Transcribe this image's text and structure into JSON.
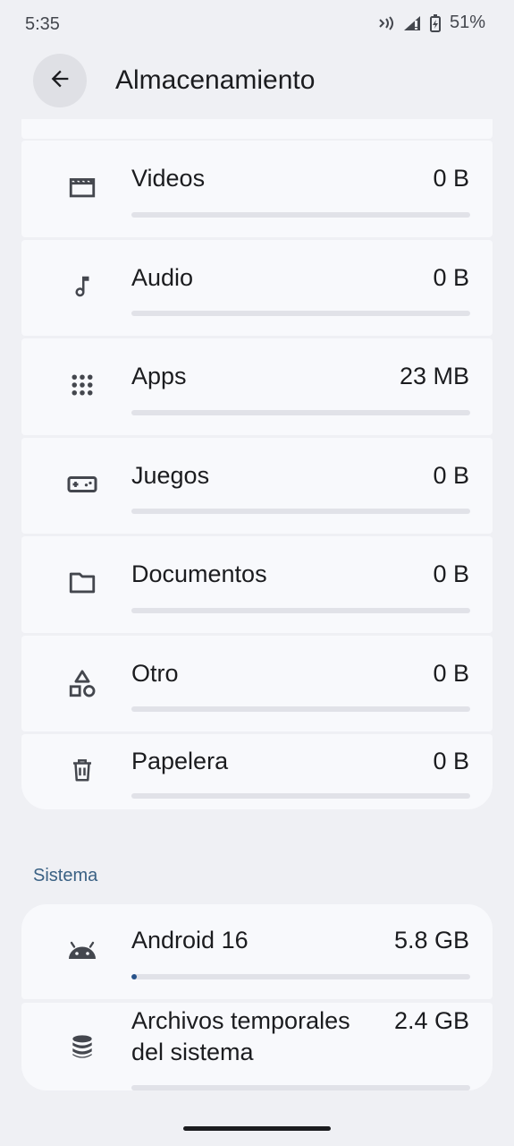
{
  "status_bar": {
    "time": "5:35",
    "battery": "51%",
    "icons": [
      "nfc-icon",
      "signal-icon",
      "battery-icon"
    ]
  },
  "app_bar": {
    "title": "Almacenamiento",
    "back_icon": "arrow-back-icon"
  },
  "categories": [
    {
      "label": "Videos",
      "value": "0 B",
      "icon": "movie-icon",
      "usage_fraction": 0
    },
    {
      "label": "Audio",
      "value": "0 B",
      "icon": "music-note-icon",
      "usage_fraction": 0
    },
    {
      "label": "Apps",
      "value": "23 MB",
      "icon": "apps-grid-icon",
      "usage_fraction": 0
    },
    {
      "label": "Juegos",
      "value": "0 B",
      "icon": "gamepad-icon",
      "usage_fraction": 0
    },
    {
      "label": "Documentos",
      "value": "0 B",
      "icon": "folder-icon",
      "usage_fraction": 0
    },
    {
      "label": "Otro",
      "value": "0 B",
      "icon": "shapes-icon",
      "usage_fraction": 0
    },
    {
      "label": "Papelera",
      "value": "0 B",
      "icon": "trash-icon",
      "usage_fraction": 0
    }
  ],
  "system_section": {
    "header": "Sistema",
    "items": [
      {
        "label": "Android 16",
        "value": "5.8 GB",
        "icon": "android-icon",
        "usage_fraction": 0.015
      },
      {
        "label_line1": "Archivos temporales",
        "label_line2": "del sistema",
        "value": "2.4 GB",
        "icon": "database-icon",
        "usage_fraction": 0
      }
    ]
  },
  "colors": {
    "background": "#eff0f4",
    "card": "#f8f9fc",
    "accent": "#27528a",
    "section_header": "#3a6184",
    "track": "#e1e2e8"
  }
}
